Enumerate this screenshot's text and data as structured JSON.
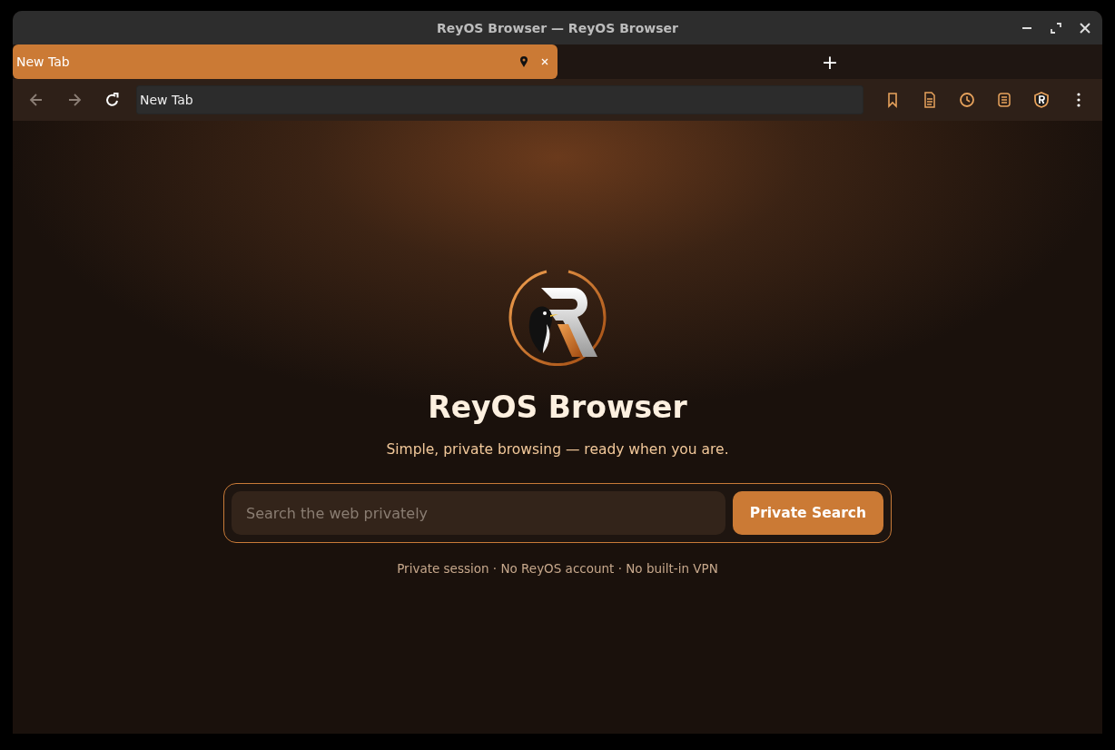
{
  "window": {
    "title": "ReyOS Browser — ReyOS Browser"
  },
  "tabs": [
    {
      "label": "New Tab",
      "selected": true
    }
  ],
  "new_tab": {
    "label": "+"
  },
  "nav": [
    {
      "kind": "back",
      "disabled": true
    },
    {
      "kind": "forward",
      "disabled": true
    },
    {
      "kind": "reload",
      "disabled": false
    }
  ],
  "address": {
    "value": "New Tab"
  },
  "home": {
    "title": "ReyOS Browser",
    "tagline": "Simple, private browsing — ready when you are.",
    "search": {
      "placeholder": "Search the web privately",
      "button": "Private Search"
    },
    "note": "Private session · No ReyOS account · No built-in VPN"
  }
}
